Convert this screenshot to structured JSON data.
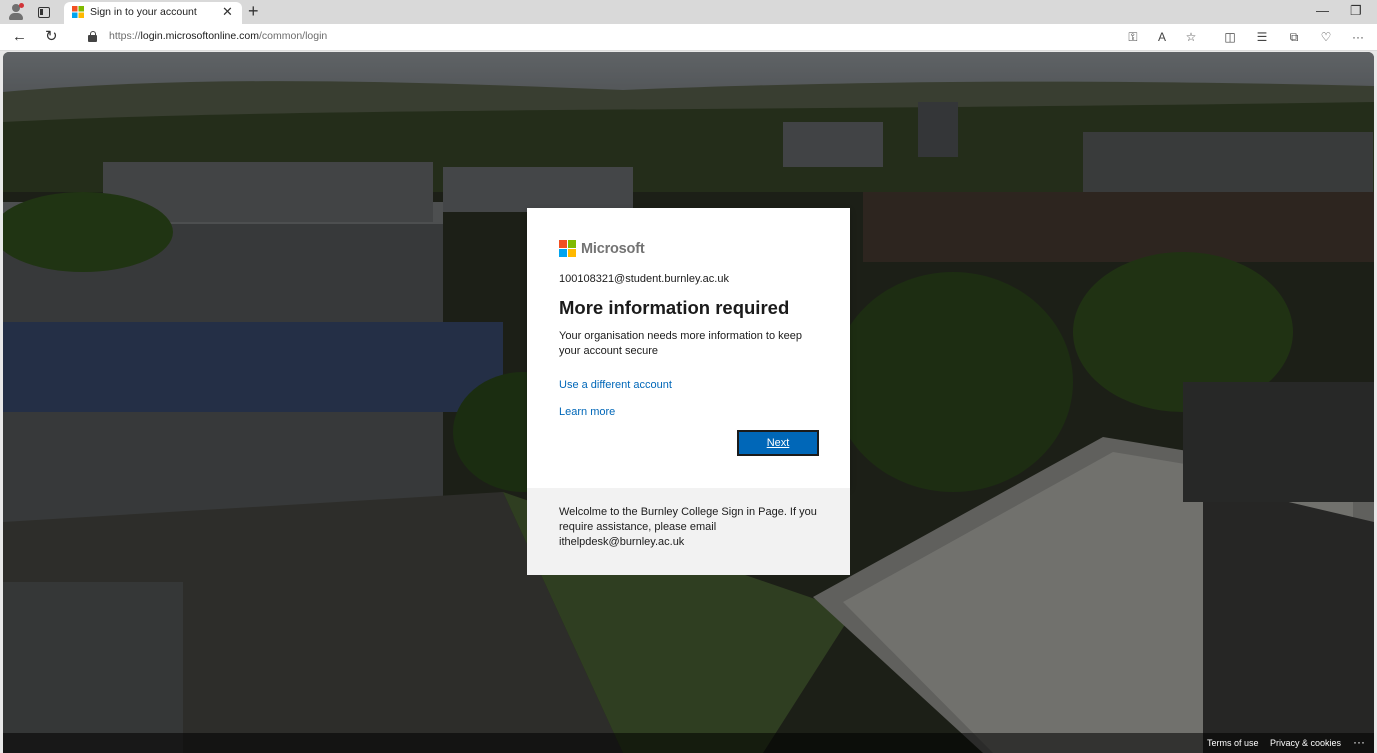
{
  "browser": {
    "tab_title": "Sign in to your account",
    "tab_close": "✕",
    "new_tab": "+",
    "url_protocol": "https://",
    "url_host": "login.microsoftonline.com",
    "url_path": "/common/login",
    "window_minimize": "—",
    "window_maximize": "❐",
    "toolbar_icons": [
      "key-icon",
      "read-aloud-icon",
      "favorite-icon",
      "split-screen-icon",
      "favorites-icon",
      "collections-icon",
      "browser-essentials-icon",
      "more-icon"
    ]
  },
  "card": {
    "logo_text": "Microsoft",
    "identity": "100108321@student.burnley.ac.uk",
    "heading": "More information required",
    "description": "Your organisation needs more information to keep your account secure",
    "link_different_account": "Use a different account",
    "link_learn_more": "Learn more",
    "next_button": "Next"
  },
  "banner": {
    "text": "Welcolme to the Burnley College Sign in Page. If you require assistance, please email ithelpdesk@burnley.ac.uk"
  },
  "footer": {
    "terms": "Terms of use",
    "privacy": "Privacy & cookies",
    "more": "···"
  },
  "colors": {
    "accent": "#0067b8",
    "ms_red": "#f25022",
    "ms_green": "#7fba00",
    "ms_blue": "#00a4ef",
    "ms_yellow": "#ffb900"
  }
}
